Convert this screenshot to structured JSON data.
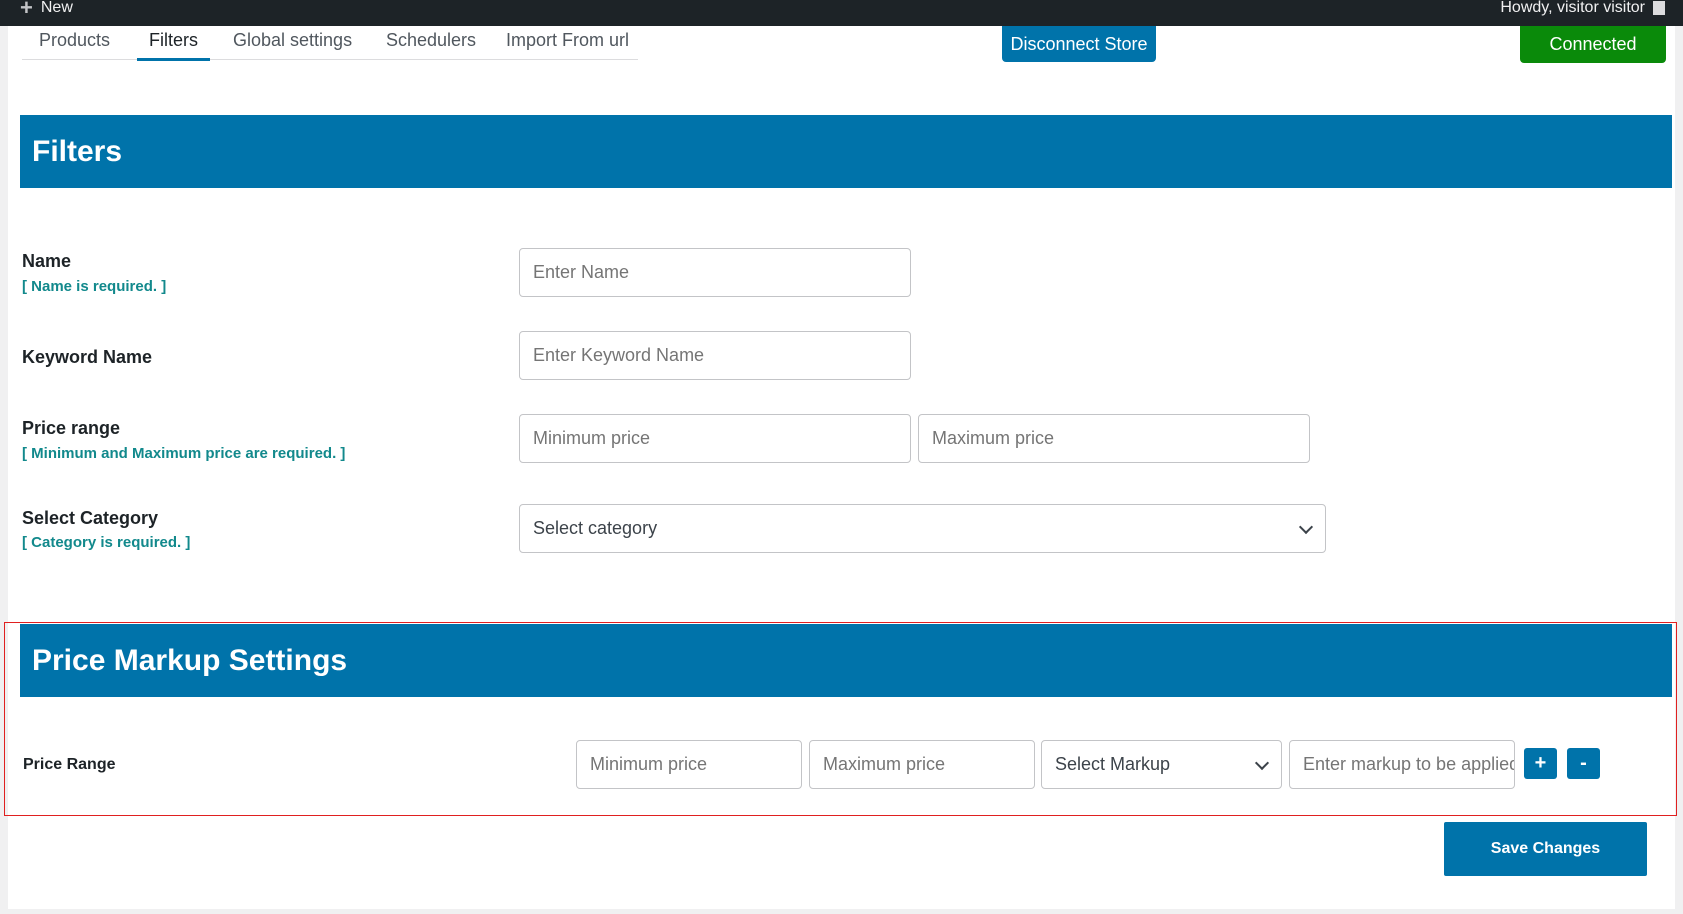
{
  "adminbar": {
    "new_label": "New",
    "howdy": "Howdy, visitor visitor"
  },
  "tabs": [
    {
      "label": "Products"
    },
    {
      "label": "Filters"
    },
    {
      "label": "Global settings"
    },
    {
      "label": "Schedulers"
    },
    {
      "label": "Import From url"
    }
  ],
  "active_tab": "Filters",
  "store": {
    "disconnect_label": "Disconnect Store",
    "status_label": "Connected",
    "status_color": "#0a8a0a"
  },
  "filters": {
    "title": "Filters",
    "name": {
      "label": "Name",
      "note": "[ Name is required. ]",
      "placeholder": "Enter Name"
    },
    "keyword": {
      "label": "Keyword Name",
      "placeholder": "Enter Keyword Name"
    },
    "price": {
      "label": "Price range",
      "note": "[ Minimum and Maximum price are required. ]",
      "min_placeholder": "Minimum price",
      "max_placeholder": "Maximum price"
    },
    "category": {
      "label": "Select Category",
      "note": "[ Category is required. ]",
      "selected": "Select category"
    }
  },
  "markup": {
    "title": "Price Markup Settings",
    "row_label": "Price Range",
    "min_placeholder": "Minimum price",
    "max_placeholder": "Maximum price",
    "select_markup": "Select Markup",
    "markup_placeholder": "Enter markup to be applied",
    "add_label": "+",
    "remove_label": "-"
  },
  "save_label": "Save Changes",
  "colors": {
    "primary": "#0073aa",
    "note": "#12898c",
    "highlight_border": "#e02020"
  }
}
